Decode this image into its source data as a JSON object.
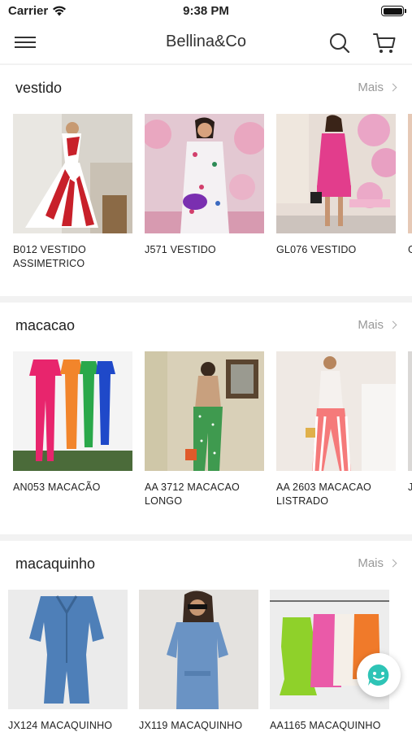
{
  "status": {
    "carrier": "Carrier",
    "time": "9:38 PM",
    "battery_level": 1.0
  },
  "header": {
    "title": "Bellina&Co"
  },
  "sections": [
    {
      "title": "vestido",
      "more_label": "Mais",
      "products": [
        {
          "name": "B012 VESTIDO ASSIMETRICO"
        },
        {
          "name": "J571 VESTIDO"
        },
        {
          "name": "GL076 VESTIDO"
        },
        {
          "name": "G"
        }
      ]
    },
    {
      "title": "macacao",
      "more_label": "Mais",
      "products": [
        {
          "name": "AN053 MACACÃO"
        },
        {
          "name": "AA 3712 MACACAO LONGO"
        },
        {
          "name": "AA 2603 MACACAO LISTRADO"
        },
        {
          "name": "J"
        }
      ]
    },
    {
      "title": "macaquinho",
      "more_label": "Mais",
      "products": [
        {
          "name": "JX124 MACAQUINHO"
        },
        {
          "name": "JX119 MACAQUINHO"
        },
        {
          "name": "AA1165 MACAQUINHO"
        }
      ]
    }
  ],
  "colors": {
    "chat_accent": "#2ec4b6",
    "divider": "#f2f2f2",
    "muted": "#999999"
  }
}
